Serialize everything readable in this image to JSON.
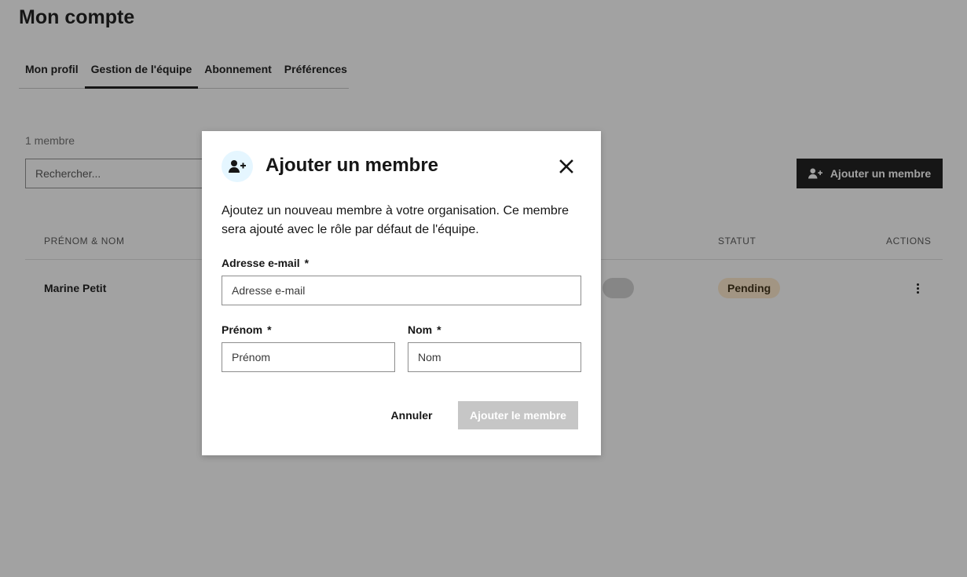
{
  "page": {
    "title": "Mon compte"
  },
  "tabs": [
    {
      "label": "Mon profil",
      "active": false
    },
    {
      "label": "Gestion de l'équipe",
      "active": true
    },
    {
      "label": "Abonnement",
      "active": false
    },
    {
      "label": "Préférences",
      "active": false
    }
  ],
  "team": {
    "member_count": "1 membre",
    "search_placeholder": "Rechercher...",
    "add_button_label": "Ajouter un membre",
    "columns": {
      "name": "PRÉNOM & NOM",
      "status": "STATUT",
      "actions": "ACTIONS"
    },
    "rows": [
      {
        "name": "Marine Petit",
        "status": "Pending"
      }
    ]
  },
  "modal": {
    "title": "Ajouter un membre",
    "description": "Ajoutez un nouveau membre à votre organisation. Ce membre sera ajouté avec le rôle par défaut de l'équipe.",
    "email": {
      "label": "Adresse e-mail",
      "required_mark": "*",
      "placeholder": "Adresse e-mail",
      "value": ""
    },
    "first_name": {
      "label": "Prénom",
      "required_mark": "*",
      "placeholder": "Prénom",
      "value": ""
    },
    "last_name": {
      "label": "Nom",
      "required_mark": "*",
      "placeholder": "Nom",
      "value": ""
    },
    "cancel_label": "Annuler",
    "submit_label": "Ajouter le membre",
    "submit_disabled": true
  },
  "icons": {
    "add_user": "add-user-icon",
    "close": "close-icon",
    "more": "overflow-menu-icon"
  },
  "colors": {
    "primary": "#161616",
    "status_pending_bg": "#ffeacc",
    "icon_bg": "#e5f6ff",
    "disabled_button": "#c6c6c6"
  }
}
